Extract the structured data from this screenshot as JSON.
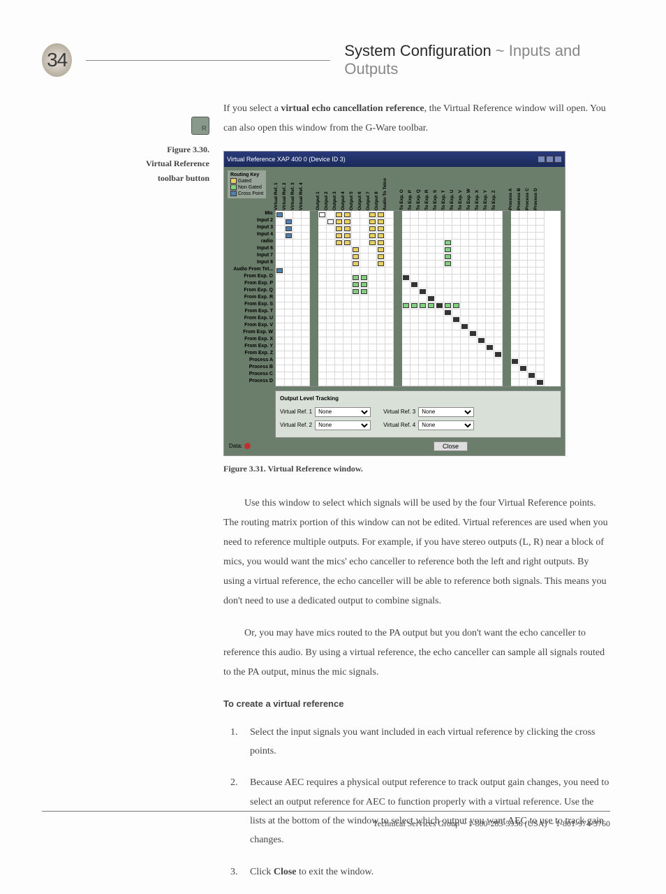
{
  "page_number": "34",
  "header": {
    "strong": "System Configuration",
    "sep": " ~ ",
    "light": "Inputs and Outputs"
  },
  "sidebar": {
    "caption_l1": "Figure 3.30.",
    "caption_l2": "Virtual Reference",
    "caption_l3": "toolbar button"
  },
  "intro": {
    "pre": "If you select a ",
    "bold": "virtual echo cancellation reference",
    "post": ", the Virtual Reference window will open. You can also open this window from the G-Ware toolbar."
  },
  "fig31": {
    "title": "Virtual Reference XAP 400 0 (Device ID 3)",
    "routing_key_title": "Routing Key",
    "k1": "Gated",
    "k2": "Non Gated",
    "k3": "Cross Point",
    "cols": [
      "Virtual Ref. 1",
      "Virtual Ref. 2",
      "Virtual Ref. 3",
      "Virtual Ref. 4",
      "",
      "Output 1",
      "Output 2",
      "Output 3",
      "Output 4",
      "Output 5",
      "Output 6",
      "Output 7",
      "Output 8",
      "Audio To Telco",
      "",
      "To Exp. O",
      "To Exp. P",
      "To Exp. Q",
      "To Exp. R",
      "To Exp. S",
      "To Exp. T",
      "To Exp. U",
      "To Exp. V",
      "To Exp. W",
      "To Exp. X",
      "To Exp. Y",
      "To Exp. Z",
      "",
      "Process A",
      "Process B",
      "Process C",
      "Process D"
    ],
    "rows": [
      "Mic",
      "Input 2",
      "Input 3",
      "Input 4",
      "radio",
      "Input 6",
      "Input 7",
      "Input 8",
      "Audio From Tel...",
      "From Exp. O",
      "From Exp. P",
      "From Exp. Q",
      "From Exp. R",
      "From Exp. S",
      "From Exp. T",
      "From Exp. U",
      "From Exp. V",
      "From Exp. W",
      "From Exp. X",
      "From Exp. Y",
      "From Exp. Z",
      "Process A",
      "Process B",
      "Process C",
      "Process D"
    ],
    "ot_title": "Output Level Tracking",
    "vr1_label": "Virtual Ref. 1",
    "vr2_label": "Virtual Ref. 2",
    "vr3_label": "Virtual Ref. 3",
    "vr4_label": "Virtual Ref. 4",
    "none": "None",
    "data_label": "Data:",
    "close": "Close",
    "caption": "Figure 3.31. Virtual Reference window."
  },
  "para1": "Use this window to select which signals will be used by the four Virtual Reference points. The routing matrix portion of this window can not be edited. Virtual references are used when you need to reference multiple outputs. For example, if you have stereo outputs (L, R) near a block of mics, you would want the mics' echo canceller to reference both the left and right outputs. By using a virtual reference, the echo canceller will be able to reference both signals. This means you don't need to use a dedicated output to combine signals.",
  "para2": "Or, you may have mics routed to the PA output but you don't want the echo canceller to reference this audio. By using a virtual reference, the echo canceller can sample all signals routed to the PA output, minus the mic signals.",
  "subhead": "To create a virtual reference",
  "steps": {
    "s1": "Select the input signals you want included in each virtual reference by clicking the cross points.",
    "s2": "Because AEC requires a physical output reference to track output gain changes, you need to select an output reference for AEC to function properly with a virtual reference. Use the lists at the bottom of the window to select which output you want AEC to use to track gain changes.",
    "s3_pre": "Click ",
    "s3_bold": "Close",
    "s3_post": " to exit the window."
  },
  "footer": "Technical Services Group ~ 1-800-283-5936 (USA) ~ 1-801-974-3760"
}
